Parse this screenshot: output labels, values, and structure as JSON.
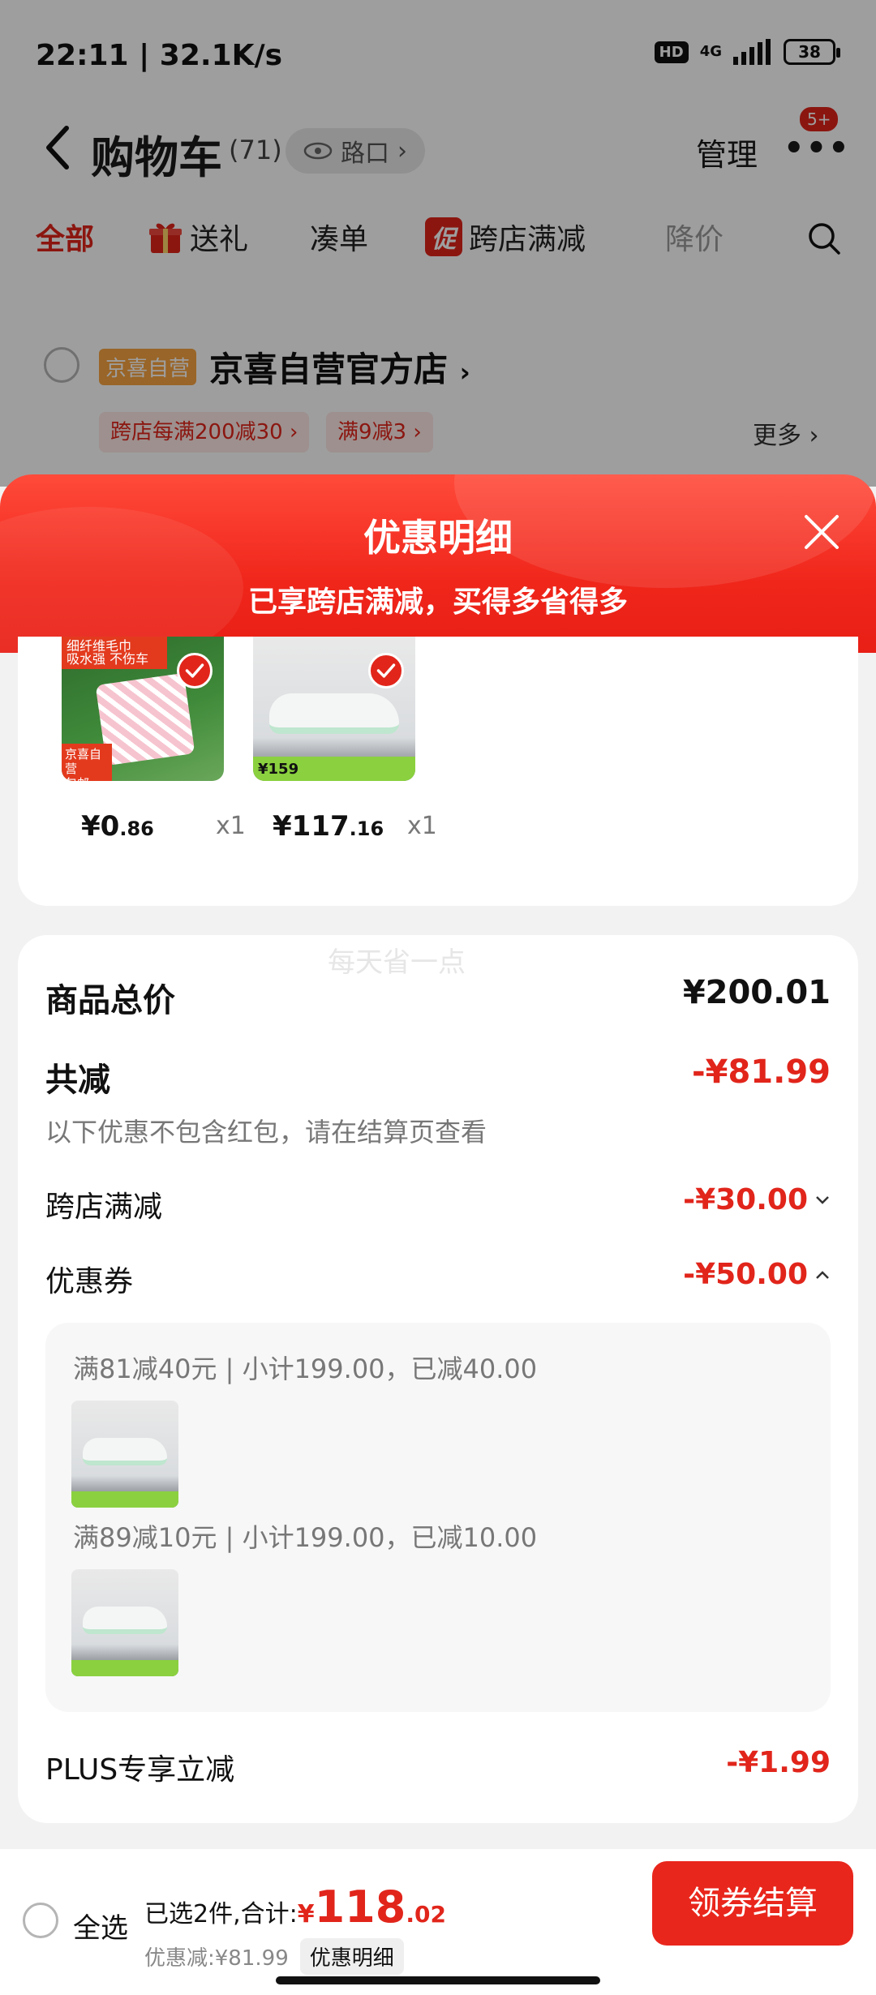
{
  "status_bar": {
    "time_speed": "22:11 | 32.1K/s",
    "hd": "HD",
    "network": "4G",
    "battery": "38"
  },
  "nav": {
    "title": "购物车",
    "count": "(71)",
    "entry": "路口",
    "manage": "管理",
    "badge": "5+"
  },
  "filter_tabs": [
    {
      "label": "全部",
      "state": "active"
    },
    {
      "label": "送礼",
      "icon": "gift-icon"
    },
    {
      "label": "凑单"
    },
    {
      "label": "跨店满减",
      "tag": "促"
    },
    {
      "label": "降价",
      "state": "muted"
    }
  ],
  "store": {
    "tag": "京喜自营",
    "name": "京喜自营官方店",
    "promos": [
      "跨店每满200减30 ›",
      "满9减3 ›"
    ],
    "more": "更多 ›"
  },
  "sheet": {
    "title": "优惠明细",
    "subtitle": "已享跨店满减，买得多省得多"
  },
  "goods": [
    {
      "price_main": "¥0",
      "price_dec": ".86",
      "qty": "x1",
      "thumb_text_top": "细纤维毛巾",
      "thumb_text_mid": "吸水强 不伤车",
      "thumb_tag": "京喜自营",
      "thumb_tag2": "包邮"
    },
    {
      "price_main": "¥117",
      "price_dec": ".16",
      "qty": "x1",
      "thumb_tag": "¥159"
    }
  ],
  "summary": {
    "watermark": "每天省一点",
    "total_label": "商品总价",
    "total_value": "¥200.01",
    "reduce_label": "共减",
    "reduce_value": "-¥81.99",
    "reduce_note": "以下优惠不包含红包，请在结算页查看",
    "cross_label": "跨店满减",
    "cross_value": "-¥30.00",
    "coupon_label": "优惠券",
    "coupon_value": "-¥50.00",
    "coupons": [
      {
        "line": "满81减40元 | 小计199.00，已减40.00"
      },
      {
        "line": "满89减10元 | 小计199.00，已减10.00"
      }
    ],
    "plus_label": "PLUS专享立减",
    "plus_value": "-¥1.99"
  },
  "bottom": {
    "select_all": "全选",
    "selected": "已选2件,合计:",
    "yen": "¥",
    "total_main": "118",
    "total_dec": ".02",
    "saved": "优惠减:¥81.99",
    "detail": "优惠明细",
    "checkout": "领券结算"
  },
  "colors": {
    "accent": "#e1251b",
    "button": "#e9261c"
  }
}
